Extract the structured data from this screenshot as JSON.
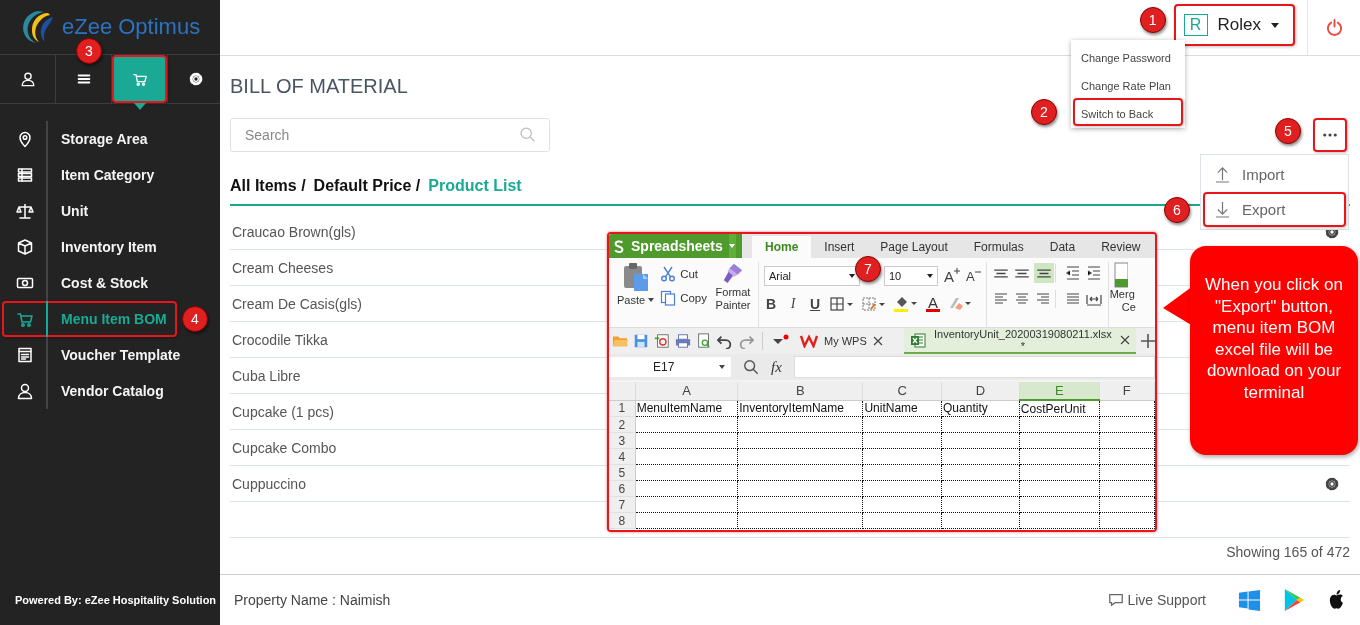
{
  "sidebar": {
    "logo_text": "eZee Optimus",
    "tabs": [
      {
        "kind": "user",
        "selected": false,
        "highlighted": false
      },
      {
        "kind": "menu",
        "selected": false,
        "highlighted": false
      },
      {
        "kind": "cart",
        "selected": true,
        "highlighted": true,
        "marker": "3"
      },
      {
        "kind": "gear",
        "selected": false,
        "highlighted": false
      }
    ],
    "items": [
      {
        "label": "Storage Area",
        "kind": "pin",
        "selected": false,
        "highlighted": false
      },
      {
        "label": "Item Category",
        "kind": "list",
        "selected": false,
        "highlighted": false
      },
      {
        "label": "Unit",
        "kind": "scale",
        "selected": false,
        "highlighted": false
      },
      {
        "label": "Inventory Item",
        "kind": "box",
        "selected": false,
        "highlighted": false
      },
      {
        "label": "Cost & Stock",
        "kind": "money",
        "selected": false,
        "highlighted": false
      },
      {
        "label": "Menu Item BOM",
        "kind": "cart",
        "selected": true,
        "highlighted": true,
        "marker": "4"
      },
      {
        "label": "Voucher Template",
        "kind": "voucher",
        "selected": false,
        "highlighted": false
      },
      {
        "label": "Vendor Catalog",
        "kind": "user",
        "selected": false,
        "highlighted": false
      }
    ],
    "powered_by": "Powered By: eZee Hospitality Solution"
  },
  "header": {
    "user": {
      "initial": "R",
      "name": "Rolex",
      "highlighted": true,
      "marker": "1"
    }
  },
  "user_menu": {
    "items": [
      {
        "label": "Change Password",
        "highlighted": false
      },
      {
        "label": "Change Rate Plan",
        "highlighted": false
      },
      {
        "label": "Switch to Back",
        "highlighted": true,
        "marker": "2"
      }
    ]
  },
  "page": {
    "title": "BILL OF MATERIAL",
    "search": {
      "placeholder": "Search"
    },
    "more_button": {
      "highlighted": true,
      "marker": "5"
    },
    "breadcrumb": [
      {
        "label": "All Items /",
        "selected": false
      },
      {
        "label": "Default Price /",
        "selected": false
      },
      {
        "label": "Product List",
        "selected": true
      }
    ],
    "rows": [
      {
        "name": "Craucao Brown(gls)",
        "settings": true
      },
      {
        "name": "Cream Cheeses",
        "settings": false
      },
      {
        "name": "Cream De Casis(gls)",
        "settings": false
      },
      {
        "name": "Crocodile Tikka",
        "settings": false
      },
      {
        "name": "Cuba Libre",
        "settings": false
      },
      {
        "name": "Cupcake (1 pcs)",
        "settings": false
      },
      {
        "name": "Cupcake Combo",
        "settings": false
      },
      {
        "name": "Cuppuccino",
        "settings": true
      }
    ],
    "count": "Showing 165 of 472"
  },
  "more_menu": {
    "items": [
      {
        "label": "Import",
        "kind": "upload",
        "highlighted": false
      },
      {
        "label": "Export",
        "kind": "download",
        "highlighted": true,
        "marker": "6"
      }
    ]
  },
  "spreadsheet": {
    "app_name": "Spreadsheets",
    "marker": "7",
    "tabs": [
      {
        "label": "Home",
        "selected": true
      },
      {
        "label": "Insert",
        "selected": false
      },
      {
        "label": "Page Layout",
        "selected": false
      },
      {
        "label": "Formulas",
        "selected": false
      },
      {
        "label": "Data",
        "selected": false
      },
      {
        "label": "Review",
        "selected": false
      }
    ],
    "clipboard": {
      "paste": "Paste",
      "cut": "Cut",
      "copy": "Copy",
      "format_painter": "Format Painter"
    },
    "font": {
      "name": "Arial",
      "size": "10",
      "grow": "A",
      "shrink": "A",
      "bold": "B",
      "italic": "I",
      "underline": "U",
      "color_letter": "A"
    },
    "merge_label": [
      "Merg",
      "Ce"
    ],
    "doc_tabs": [
      {
        "label": "My WPS",
        "selected": false
      },
      {
        "label": "InventoryUnit_20200319080211.xlsx *",
        "selected": true
      }
    ],
    "cell_ref": "E17",
    "fx": "fx",
    "columns": [
      {
        "label": "A",
        "selected": false
      },
      {
        "label": "B",
        "selected": false
      },
      {
        "label": "C",
        "selected": false
      },
      {
        "label": "D",
        "selected": false
      },
      {
        "label": "E",
        "selected": true
      },
      {
        "label": "F",
        "selected": false
      }
    ],
    "rows": [
      {
        "number": "1",
        "cells": [
          "MenuItemName",
          "InventoryItemName",
          "UnitName",
          "Quantity",
          "CostPerUnit"
        ]
      },
      {
        "number": "2"
      },
      {
        "number": "3"
      },
      {
        "number": "4"
      },
      {
        "number": "5"
      },
      {
        "number": "6"
      },
      {
        "number": "7"
      },
      {
        "number": "8"
      }
    ]
  },
  "callout": {
    "text": "When you click on \"Export\" button, menu item BOM excel file will be download on your terminal"
  },
  "footer": {
    "property": "Property Name : Naimish",
    "live_support": "Live Support"
  }
}
